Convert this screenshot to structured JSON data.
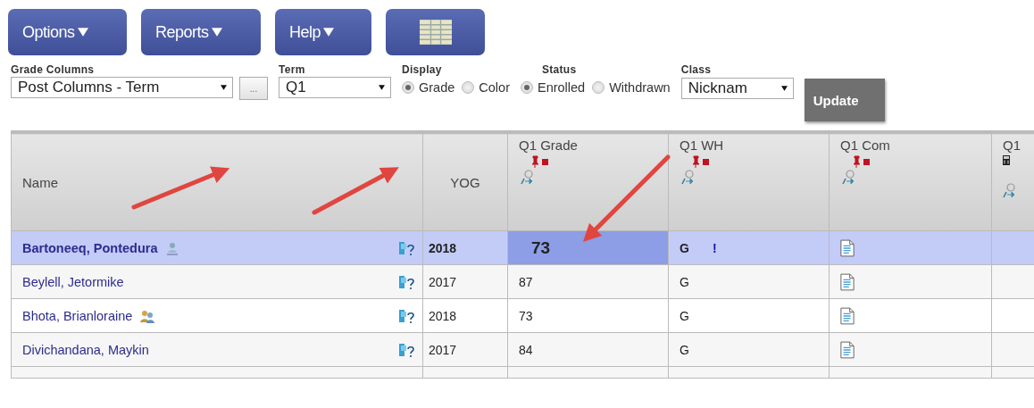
{
  "menu_buttons": [
    {
      "label": "Options",
      "kind": "menu"
    },
    {
      "label": "Reports",
      "kind": "menu"
    },
    {
      "label": "Help",
      "kind": "menu"
    },
    {
      "kind": "grid"
    }
  ],
  "filters": {
    "grade_columns": {
      "label": "Grade Columns",
      "value": "Post Columns - Term",
      "more": "..."
    },
    "term": {
      "label": "Term",
      "value": "Q1"
    },
    "display": {
      "label": "Display",
      "options": [
        {
          "label": "Grade",
          "selected": true
        },
        {
          "label": "Color",
          "selected": false
        }
      ]
    },
    "status": {
      "label": "Status",
      "options": [
        {
          "label": "Enrolled",
          "selected": true
        },
        {
          "label": "Withdrawn",
          "selected": false
        }
      ]
    },
    "class": {
      "label": "Class",
      "value": "Nicknam"
    },
    "update": "Update"
  },
  "table": {
    "columns": [
      {
        "label": "Name",
        "kind": "text"
      },
      {
        "label": "YOG",
        "kind": "text"
      },
      {
        "label": "Q1 Grade",
        "kind": "posted"
      },
      {
        "label": "Q1 WH",
        "kind": "posted"
      },
      {
        "label": "Q1 Com",
        "kind": "posted"
      },
      {
        "label": "Q1",
        "kind": "calc"
      }
    ],
    "rows": [
      {
        "name": "Bartoneeq, Pontedura",
        "badge": {
          "kind": "contact"
        },
        "yog": "2018",
        "grade": "73",
        "wh": "G",
        "wh_flag": "!",
        "selected": true
      },
      {
        "name": "Beylell, Jetormike",
        "yog": "2017",
        "grade": "87",
        "wh": "G",
        "selected": false
      },
      {
        "name": "Bhota, Brianloraine",
        "badge": {
          "kind": "group"
        },
        "yog": "2018",
        "grade": "73",
        "wh": "G",
        "selected": false
      },
      {
        "name": "Divichandana, Maykin",
        "yog": "2017",
        "grade": "84",
        "wh": "G",
        "selected": false
      }
    ]
  }
}
